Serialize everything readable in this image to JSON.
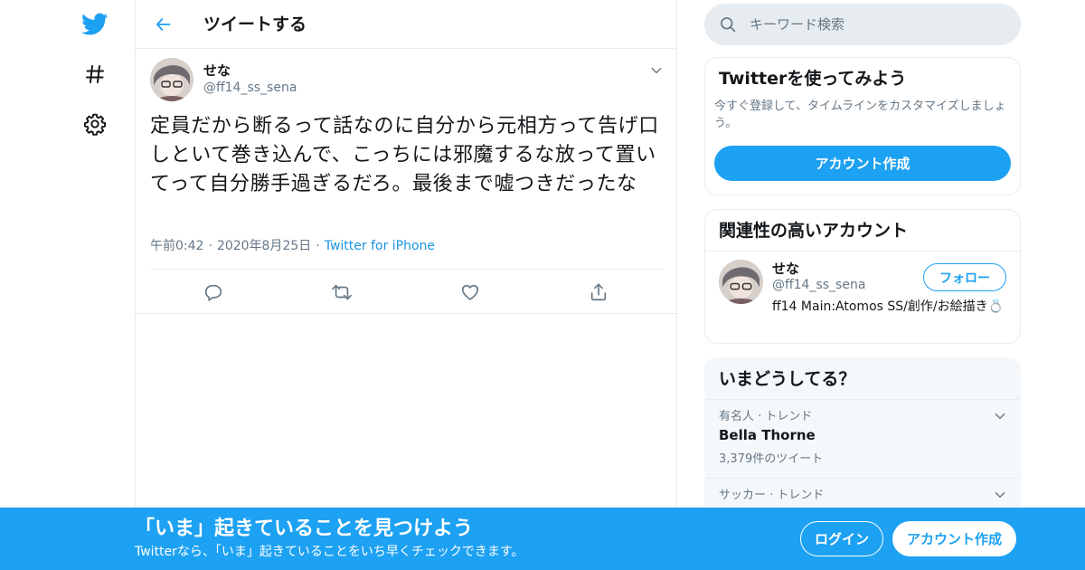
{
  "colors": {
    "accent": "#1da1f2",
    "link": "#1b95e0",
    "text": "#14171a",
    "secondary_text": "#657786",
    "border": "#e6ecf0",
    "search_bg": "#e6ecf0",
    "trends_bg": "#f5f8fa"
  },
  "nav": {
    "icons": [
      "twitter-logo-icon",
      "hashtag-icon",
      "gear-icon"
    ]
  },
  "header": {
    "back_icon": "arrow-left-icon",
    "title": "ツイートする"
  },
  "tweet": {
    "author_name": "せな",
    "author_handle": "@ff14_ss_sena",
    "text": "定員だから断るって話なのに自分から元相方って告げ口しといて巻き込んで、こっちには邪魔するな放って置いてって自分勝手過ぎるだろ。最後まで嘘つきだったな",
    "time": "午前0:42",
    "date": "2020年8月25日",
    "separator": "·",
    "source": "Twitter for iPhone",
    "actions": [
      "reply-icon",
      "retweet-icon",
      "like-icon",
      "share-icon"
    ]
  },
  "search": {
    "placeholder": "キーワード検索"
  },
  "signup_card": {
    "title": "Twitterを使ってみよう",
    "description": "今すぐ登録して、タイムラインをカスタマイズしましょう。",
    "button_label": "アカウント作成"
  },
  "related_card": {
    "title": "関連性の高いアカウント",
    "account": {
      "name": "せな",
      "handle": "@ff14_ss_sena",
      "follow_label": "フォロー",
      "bio": "ff14 Main:Atomos SS/創作/お絵描き💍"
    }
  },
  "trends_card": {
    "title": "いまどうしてる？",
    "trends": [
      {
        "context": "有名人 · トレンド",
        "name": "Bella Thorne",
        "count": "3,379件のツイート"
      },
      {
        "context": "サッカー · トレンド"
      }
    ]
  },
  "banner": {
    "title": "「いま」起きていることを見つけよう",
    "subtitle": "Twitterなら、「いま」起きていることをいち早くチェックできます。",
    "login_label": "ログイン",
    "signup_label": "アカウント作成"
  }
}
